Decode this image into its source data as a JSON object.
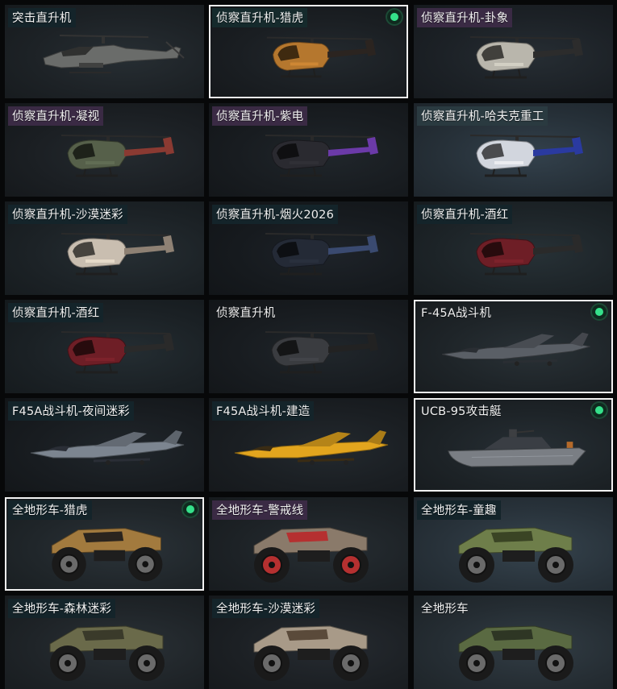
{
  "items": [
    {
      "name": "突击直升机",
      "kind": "attack-heli",
      "selected": false,
      "equipped": false,
      "color": "#6a6c6a",
      "accent": "#3a3c3a",
      "bg": "#1d2226",
      "label_bg": "#14242a"
    },
    {
      "name": "侦察直升机-猎虎",
      "kind": "scout-heli",
      "selected": true,
      "equipped": true,
      "color": "#b5772e",
      "accent": "#2b2420",
      "bg": "#1a1e22",
      "label_bg": "#152a2c"
    },
    {
      "name": "侦察直升机-卦象",
      "kind": "scout-heli",
      "selected": false,
      "equipped": false,
      "color": "#b9b6ac",
      "accent": "#2c2c2c",
      "bg": "#1c2126",
      "label_bg": "#3a2a44"
    },
    {
      "name": "侦察直升机-凝视",
      "kind": "scout-heli",
      "selected": false,
      "equipped": false,
      "color": "#56604a",
      "accent": "#8a3a32",
      "bg": "#1b1f23",
      "label_bg": "#3a2a44"
    },
    {
      "name": "侦察直升机-紫电",
      "kind": "scout-heli",
      "selected": false,
      "equipped": false,
      "color": "#2a2a30",
      "accent": "#6b3aa8",
      "bg": "#181c20",
      "label_bg": "#3a2a44"
    },
    {
      "name": "侦察直升机-哈夫克重工",
      "kind": "scout-heli",
      "selected": false,
      "equipped": false,
      "color": "#d2d6de",
      "accent": "#2a3aa0",
      "bg": "#263038",
      "label_bg": "#2a3a40"
    },
    {
      "name": "侦察直升机-沙漠迷彩",
      "kind": "scout-heli",
      "selected": false,
      "equipped": false,
      "color": "#c9beb0",
      "accent": "#8e8174",
      "bg": "#1c2226",
      "label_bg": "#14242a"
    },
    {
      "name": "侦察直升机-烟火2026",
      "kind": "scout-heli",
      "selected": false,
      "equipped": false,
      "color": "#242a36",
      "accent": "#3a4a70",
      "bg": "#161a1e",
      "label_bg": "#14242a"
    },
    {
      "name": "侦察直升机-酒红",
      "kind": "scout-heli",
      "selected": false,
      "equipped": false,
      "color": "#6e1e26",
      "accent": "#2a2a2a",
      "bg": "#1d2428",
      "label_bg": "#14242a"
    },
    {
      "name": "侦察直升机-酒红",
      "kind": "scout-heli",
      "selected": false,
      "equipped": false,
      "color": "#6e1e26",
      "accent": "#2a2a2a",
      "bg": "#1b2125",
      "label_bg": "#14242a"
    },
    {
      "name": "侦察直升机",
      "kind": "scout-heli",
      "selected": false,
      "equipped": false,
      "color": "#3a3c40",
      "accent": "#222",
      "bg": "#181c20",
      "label_bg": "transparent"
    },
    {
      "name": "F-45A战斗机",
      "kind": "jet",
      "selected": true,
      "equipped": true,
      "color": "#5a5f66",
      "accent": "#2a2e33",
      "bg": "#1e2428",
      "label_bg": "transparent"
    },
    {
      "name": "F45A战斗机-夜间迷彩",
      "kind": "jet",
      "selected": false,
      "equipped": false,
      "color": "#7c8590",
      "accent": "#2a2e36",
      "bg": "#181c20",
      "label_bg": "#14242a"
    },
    {
      "name": "F45A战斗机-建造",
      "kind": "jet",
      "selected": false,
      "equipped": false,
      "color": "#e2a51e",
      "accent": "#3a2c14",
      "bg": "#1a1e22",
      "label_bg": "#14242a"
    },
    {
      "name": "UCB-95攻击艇",
      "kind": "boat",
      "selected": true,
      "equipped": true,
      "color": "#7a7e84",
      "accent": "#3a3e44",
      "bg": "#1d2327",
      "label_bg": "transparent"
    },
    {
      "name": "全地形车-猎虎",
      "kind": "atv",
      "selected": true,
      "equipped": true,
      "color": "#a27a3e",
      "accent": "#2a241e",
      "bg": "#20262a",
      "label_bg": "#14242a"
    },
    {
      "name": "全地形车-警戒线",
      "kind": "atv",
      "selected": false,
      "equipped": false,
      "color": "#8a7a6a",
      "accent": "#b53030",
      "bg": "#1d2226",
      "label_bg": "#3a2a44"
    },
    {
      "name": "全地形车-童趣",
      "kind": "atv",
      "selected": false,
      "equipped": false,
      "color": "#6e7e4a",
      "accent": "#3a4424",
      "bg": "#28323a",
      "label_bg": "#14242a"
    },
    {
      "name": "全地形车-森林迷彩",
      "kind": "atv",
      "selected": false,
      "equipped": false,
      "color": "#6a6a4a",
      "accent": "#3a3a2a",
      "bg": "#1f2428",
      "label_bg": "#14242a"
    },
    {
      "name": "全地形车-沙漠迷彩",
      "kind": "atv",
      "selected": false,
      "equipped": false,
      "color": "#a89a88",
      "accent": "#5a4a3a",
      "bg": "#1c2024",
      "label_bg": "#14242a"
    },
    {
      "name": "全地形车",
      "kind": "atv",
      "selected": false,
      "equipped": false,
      "color": "#5a6a42",
      "accent": "#2e3624",
      "bg": "#252d33",
      "label_bg": "transparent"
    }
  ]
}
